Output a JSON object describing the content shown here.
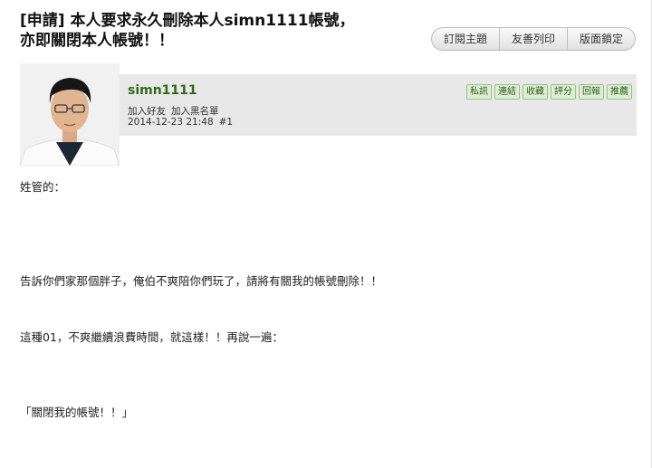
{
  "thread": {
    "title_line1": "[申請] 本人要求永久刪除本人simn1111帳號，",
    "title_line2": "亦即關閉本人帳號！！"
  },
  "toolbar": {
    "subscribe": "訂閱主題",
    "print": "友善列印",
    "layout_lock": "版面鎖定"
  },
  "post": {
    "username": "simn1111",
    "add_friend": "加入好友",
    "add_blacklist": "加入黑名單",
    "datetime": "2014-12-23 21:48",
    "floor": "#1",
    "actions": {
      "message": "私訊",
      "link": "連結",
      "favorite": "收藏",
      "rate": "評分",
      "reply": "回報",
      "recommend": "推薦"
    },
    "content": {
      "line1": "姓管的：",
      "line2": "告訴你們家那個胖子，俺伯不爽陪你們玩了，請將有關我的帳號刪除！！",
      "line3": "這種01，不爽繼續浪費時間，就這樣！！再說一遍：",
      "line4": "「關閉我的帳號！！」"
    }
  }
}
